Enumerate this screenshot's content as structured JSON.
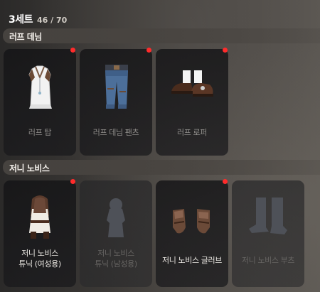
{
  "header": {
    "title": "3세트",
    "count": "46 / 70"
  },
  "groups": [
    {
      "label": "러프 데님",
      "items": [
        {
          "name": "러프 탑",
          "icon": "rough-top-icon"
        },
        {
          "name": "러프 데님 팬츠",
          "icon": "rough-denim-pants-icon"
        },
        {
          "name": "러프 로퍼",
          "icon": "rough-loafer-icon"
        }
      ]
    },
    {
      "label": "저니 노비스",
      "items": [
        {
          "name": "저니 노비스 튜닉 (여성용)",
          "line1": "저니 노비스",
          "line2": "튜닉 (여성용)",
          "icon": "tunic-female-icon"
        },
        {
          "name": "저니 노비스 튜닉 (남성용)",
          "line1": "저니 노비스",
          "line2": "튜닉 (남성용)",
          "icon": "tunic-male-silhouette-icon"
        },
        {
          "name": "저니 노비스 글러브",
          "icon": "gloves-icon"
        },
        {
          "name": "저니 노비스 부츠",
          "icon": "boots-silhouette-icon"
        }
      ]
    }
  ],
  "colors": {
    "new_dot": "#ff2b2b",
    "locked_silhouette": "#4e5158"
  }
}
